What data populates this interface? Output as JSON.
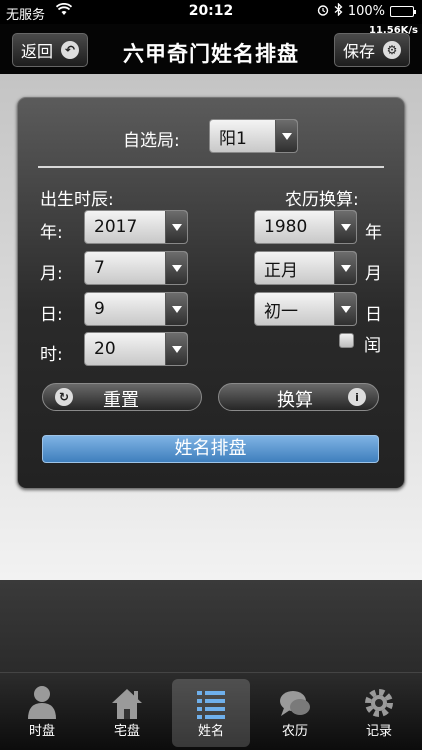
{
  "statusbar": {
    "carrier": "无服务",
    "time": "20:12",
    "battery": "100%"
  },
  "navbar": {
    "speed": "11.56K/s",
    "title": "六甲奇门姓名排盘",
    "back_label": "返回",
    "save_label": "保存"
  },
  "form": {
    "self_select_label": "自选局:",
    "self_select_value": "阳1",
    "birth_label": "出生时辰:",
    "lunar_label": "农历换算:",
    "year_label": "年:",
    "month_label": "月:",
    "day_label": "日:",
    "hour_label": "时:",
    "year_value": "2017",
    "month_value": "7",
    "day_value": "9",
    "hour_value": "20",
    "lunar_year_value": "1980",
    "lunar_month_value": "正月",
    "lunar_day_value": "初一",
    "lunar_year_unit": "年",
    "lunar_month_unit": "月",
    "lunar_day_unit": "日",
    "leap_label": "闰",
    "reset_label": "重置",
    "convert_label": "换算",
    "submit_label": "姓名排盘"
  },
  "tabs": [
    {
      "label": "时盘",
      "icon": "person-icon"
    },
    {
      "label": "宅盘",
      "icon": "house-icon"
    },
    {
      "label": "姓名",
      "icon": "list-icon",
      "active": true
    },
    {
      "label": "农历",
      "icon": "chat-icon"
    },
    {
      "label": "记录",
      "icon": "gear-icon"
    }
  ]
}
